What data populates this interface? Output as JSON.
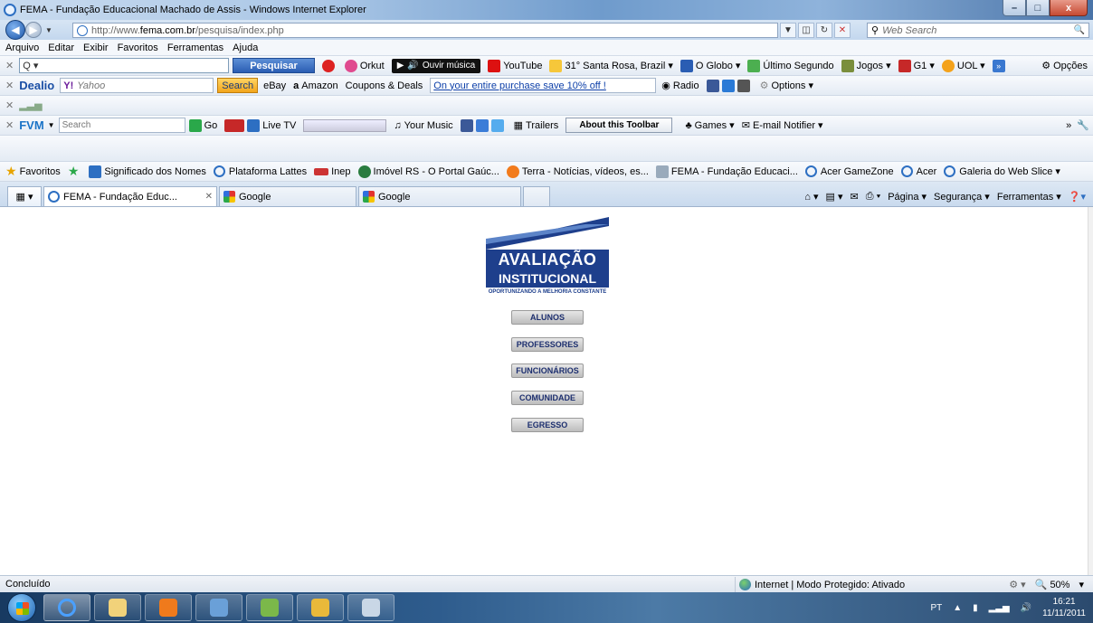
{
  "window": {
    "title": "FEMA - Fundação Educacional Machado de Assis - Windows Internet Explorer",
    "minimize": "–",
    "maximize": "□",
    "close": "x"
  },
  "address": {
    "url_prefix": "http://www.",
    "url_domain": "fema.com.br",
    "url_path": "/pesquisa/index.php",
    "websearch_placeholder": "Web Search"
  },
  "menu": [
    "Arquivo",
    "Editar",
    "Exibir",
    "Favoritos",
    "Ferramentas",
    "Ajuda"
  ],
  "toolbar_ask": {
    "search_value": "Q ▾",
    "search_button": "Pesquisar",
    "items": [
      "Orkut",
      "Ouvir música",
      "YouTube",
      "31° Santa Rosa, Brazil ▾",
      "O Globo ▾",
      "Último Segundo",
      "Jogos ▾",
      "G1 ▾",
      "UOL ▾"
    ],
    "options": "Opções"
  },
  "toolbar_dealio": {
    "brand": "Dealio",
    "yahoo_placeholder": "Yahoo",
    "search_button": "Search",
    "items": [
      "eBay",
      "Amazon",
      "Coupons & Deals"
    ],
    "promo": "On your entire purchase save 10% off !",
    "radio": "Radio",
    "options": "Options ▾"
  },
  "toolbar_fvm": {
    "brand": "FVM",
    "search_placeholder": "Search",
    "go": "Go",
    "live_tv": "Live TV",
    "your_music": "Your Music",
    "trailers": "Trailers",
    "about": "About this Toolbar",
    "games": "Games ▾",
    "email": "E-mail Notifier ▾"
  },
  "favorites": {
    "label": "Favoritos",
    "items": [
      "Significado dos Nomes",
      "Plataforma Lattes",
      "Inep",
      "Imóvel RS - O Portal Gaúc...",
      "Terra - Notícias, vídeos, es...",
      "FEMA - Fundação Educaci...",
      "Acer GameZone",
      "Acer",
      "Galeria do Web Slice ▾"
    ]
  },
  "tabs": {
    "active": "FEMA - Fundação Educ...",
    "google1": "Google",
    "google2": "Google",
    "commands": [
      "Página ▾",
      "Segurança ▾",
      "Ferramentas ▾"
    ]
  },
  "page": {
    "logo_line1": "AVALIAÇÃO",
    "logo_line2": "INSTITUCIONAL",
    "logo_tagline": "OPORTUNIZANDO A MELHORIA CONSTANTE",
    "buttons": [
      "ALUNOS",
      "PROFESSORES",
      "FUNCIONÁRIOS",
      "COMUNIDADE",
      "EGRESSO"
    ]
  },
  "status": {
    "text": "Concluído",
    "zone": "Internet | Modo Protegido: Ativado",
    "zoom": "50%"
  },
  "tray": {
    "lang": "PT",
    "time": "16:21",
    "date": "11/11/2011"
  },
  "colors": {
    "logo_blue": "#1e3f8c",
    "button_text": "#1d2f6f",
    "link": "#0b3ea8"
  }
}
